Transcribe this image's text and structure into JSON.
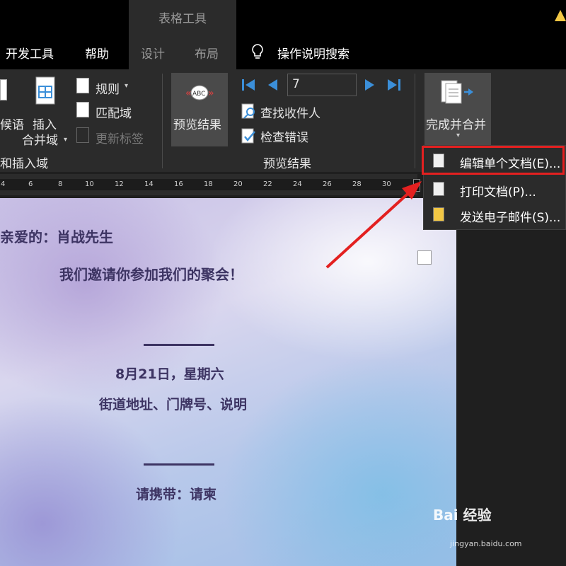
{
  "title_bar": {
    "context_tab_group": "表格工具"
  },
  "tabs": [
    {
      "label": "开发工具"
    },
    {
      "label": "帮助"
    },
    {
      "label": "设计"
    },
    {
      "label": "布局"
    },
    {
      "label": "操作说明搜索"
    }
  ],
  "ribbon": {
    "group1": {
      "greeting_label": "候语",
      "insert_field_line1": "插入",
      "insert_field_line2": "合并域",
      "rules_label": "规则",
      "match_fields_label": "匹配域",
      "update_labels_label": "更新标签",
      "group_label": "和插入域"
    },
    "group2": {
      "preview_results_label": "预览结果",
      "record_value": "7",
      "find_recipient_label": "查找收件人",
      "check_errors_label": "检查错误",
      "group_label": "预览结果"
    },
    "group3": {
      "finish_merge_label": "完成并合并"
    }
  },
  "ruler": {
    "numbers": [
      "4",
      "6",
      "8",
      "10",
      "12",
      "14",
      "16",
      "18",
      "20",
      "22",
      "24",
      "26",
      "28",
      "30"
    ]
  },
  "dropdown": {
    "items": [
      {
        "label": "编辑单个文档(E)..."
      },
      {
        "label": "打印文档(P)..."
      },
      {
        "label": "发送电子邮件(S)..."
      }
    ]
  },
  "document": {
    "line1": "亲爱的：肖战先生",
    "line2": "我们邀请你参加我们的聚会！",
    "date_line": "8月21日，星期六",
    "address_line": "街道地址、门牌号、说明",
    "bring_line": "请携带：请柬"
  },
  "watermark": {
    "brand": "Bai 经验",
    "url": "jingyan.baidu.com"
  },
  "colors": {
    "highlight": "#e32020",
    "doc_text": "#3d3463",
    "accent_blue": "#3b8fd9"
  }
}
